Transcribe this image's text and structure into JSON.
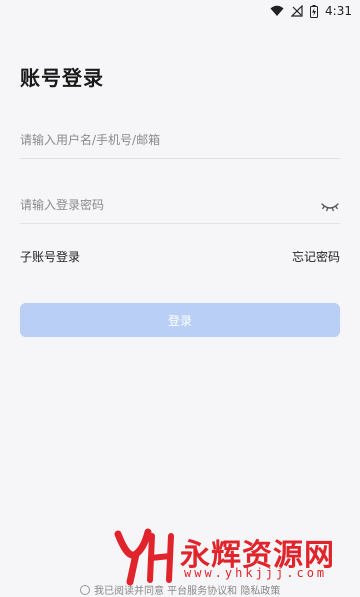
{
  "status_bar": {
    "time": "4:31",
    "icons": [
      "wifi-icon",
      "no-signal-icon",
      "battery-charging-icon"
    ]
  },
  "page": {
    "title": "账号登录"
  },
  "form": {
    "username_placeholder": "请输入用户名/手机号/邮箱",
    "username_value": "",
    "password_placeholder": "请输入登录密码",
    "password_value": "",
    "password_visibility_icon": "eye-off-icon",
    "sub_account_link": "子账号登录",
    "forgot_password_link": "忘记密码",
    "login_button": "登录"
  },
  "agreement": {
    "text": "我已阅读并同意 平台服务协议和 隐私政策"
  },
  "watermark": {
    "logo_text": "YH",
    "name": "永辉资源网",
    "url": "www.yhkjjj.com"
  },
  "colors": {
    "background": "#f6f6f8",
    "button_disabled": "#b9cff6",
    "divider": "#e2e2e6",
    "watermark": "#e0242b"
  }
}
